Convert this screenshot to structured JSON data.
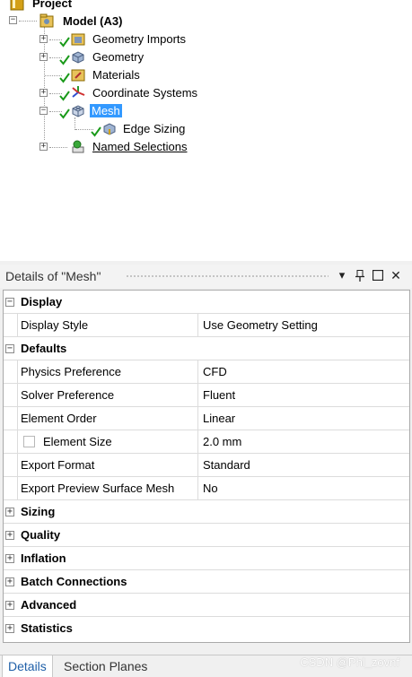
{
  "tree": {
    "project_label": "Project",
    "model_label": "Model (A3)",
    "items": [
      {
        "label": "Geometry Imports",
        "icon": "geometry-imports-icon",
        "checked": true
      },
      {
        "label": "Geometry",
        "icon": "geometry-icon",
        "checked": true
      },
      {
        "label": "Materials",
        "icon": "materials-icon",
        "checked": true
      },
      {
        "label": "Coordinate Systems",
        "icon": "coordinate-systems-icon",
        "checked": true
      },
      {
        "label": "Mesh",
        "icon": "mesh-icon",
        "checked": true,
        "selected": true
      },
      {
        "label": "Edge Sizing",
        "icon": "edge-sizing-icon",
        "checked": true
      },
      {
        "label": "Named Selections",
        "icon": "named-selections-icon",
        "checked": false
      }
    ]
  },
  "details": {
    "title": "Details of \"Mesh\"",
    "header_buttons": {
      "dropdown": "▾",
      "pin": "pin-icon",
      "restore": "restore-icon",
      "close": "✕"
    },
    "sections": {
      "display": {
        "title": "Display",
        "rows": [
          {
            "name": "Display Style",
            "value": "Use Geometry Setting"
          }
        ]
      },
      "defaults": {
        "title": "Defaults",
        "rows": [
          {
            "name": "Physics Preference",
            "value": "CFD"
          },
          {
            "name": "Solver Preference",
            "value": "Fluent"
          },
          {
            "name": "Element Order",
            "value": "Linear"
          },
          {
            "name": "Element Size",
            "value": "2.0 mm"
          },
          {
            "name": "Export Format",
            "value": "Standard"
          },
          {
            "name": "Export Preview Surface Mesh",
            "value": "No"
          }
        ]
      },
      "collapsed": [
        "Sizing",
        "Quality",
        "Inflation",
        "Batch Connections",
        "Advanced",
        "Statistics"
      ]
    },
    "expand_symbol": "+",
    "collapse_symbol": "−"
  },
  "tabs": {
    "details": "Details",
    "section_planes": "Section Planes"
  },
  "watermark": "CSDN @Phl_zovnf",
  "colors": {
    "selection": "#3399ff",
    "check": "#1a9a1a",
    "active_tab_text": "#1f5fa8"
  }
}
